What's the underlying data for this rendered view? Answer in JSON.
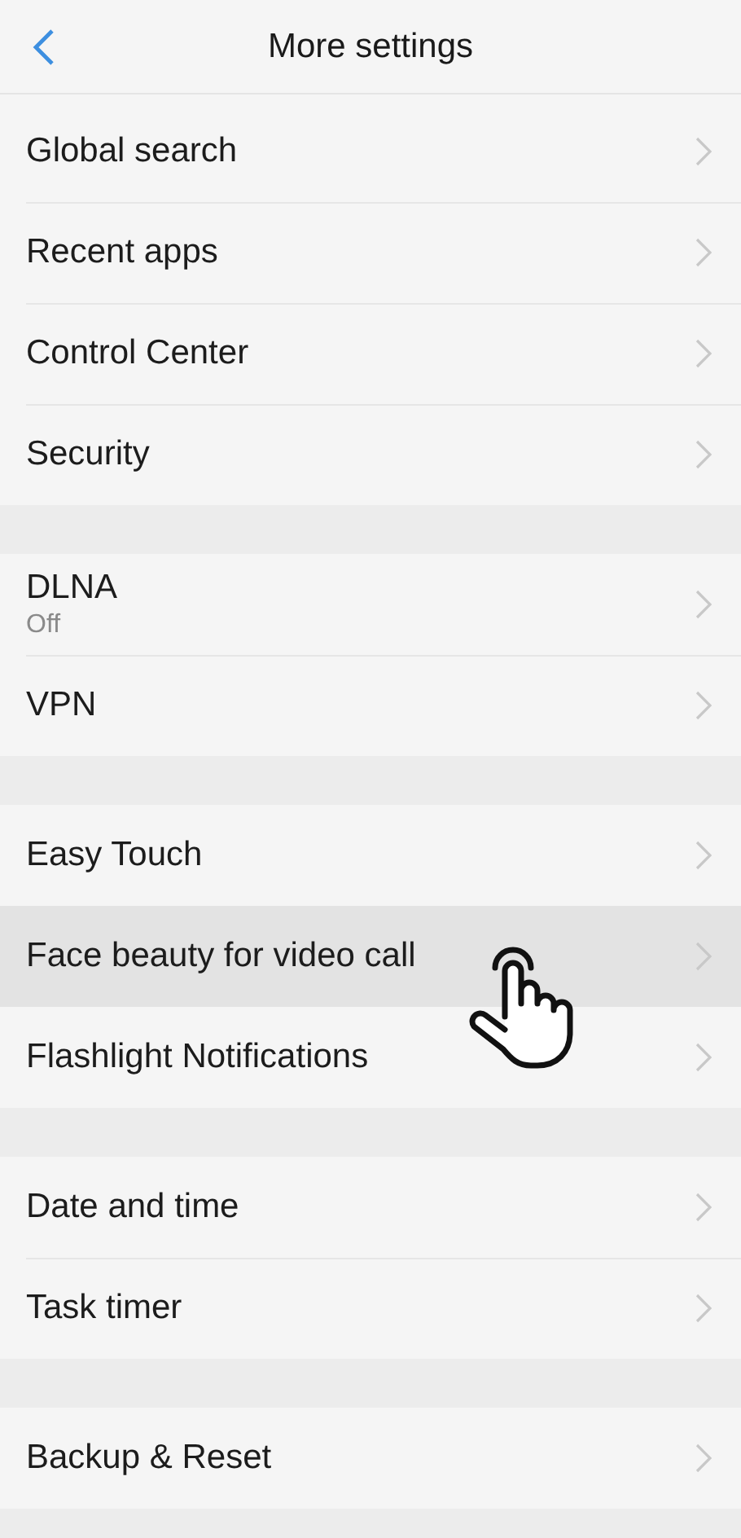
{
  "header": {
    "title": "More settings"
  },
  "groups": [
    {
      "items": [
        {
          "label": "Global search",
          "selected": false
        },
        {
          "label": "Recent apps",
          "selected": false
        },
        {
          "label": "Control Center",
          "selected": false
        },
        {
          "label": "Security",
          "selected": false
        }
      ]
    },
    {
      "items": [
        {
          "label": "DLNA",
          "value": "Off",
          "selected": false
        },
        {
          "label": "VPN",
          "selected": false
        }
      ]
    },
    {
      "items": [
        {
          "label": "Easy Touch",
          "selected": false
        },
        {
          "label": "Face beauty for video call",
          "selected": true
        },
        {
          "label": "Flashlight Notifications",
          "selected": false
        }
      ]
    },
    {
      "items": [
        {
          "label": "Date and time",
          "selected": false
        },
        {
          "label": "Task timer",
          "selected": false
        }
      ]
    },
    {
      "items": [
        {
          "label": "Backup & Reset",
          "selected": false
        }
      ]
    }
  ]
}
